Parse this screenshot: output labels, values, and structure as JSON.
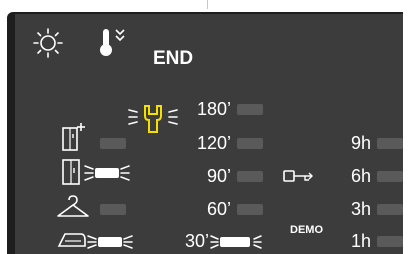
{
  "header": {
    "end_label": "END"
  },
  "timers": {
    "left_column": [
      "180’",
      "120’",
      "90’",
      "60’",
      "30’"
    ],
    "left_active": [
      false,
      false,
      false,
      false,
      true
    ],
    "right_column": [
      "9h",
      "6h",
      "3h",
      "1h"
    ],
    "right_active": [
      false,
      false,
      false,
      false
    ]
  },
  "demo_label": "DEMO",
  "icons": {
    "sun": "sun-icon",
    "thermo": "thermometer-snowflake-icon",
    "service": "wrench-service-icon",
    "fridge_plus": "fridge-add-icon",
    "fridge": "fridge-icon",
    "hanger": "hanger-icon",
    "iron": "iron-icon",
    "key": "key-icon"
  },
  "indicators": {
    "fridge_plus_active": false,
    "fridge_active": true,
    "hanger_active": false,
    "iron_active": true,
    "service_active": true
  },
  "colors": {
    "panel": "#3c3c3c",
    "bezel": "#1e1e1e",
    "accent": "#f5e000",
    "bar_off": "#5a5a5a",
    "bar_on": "#ffffff"
  }
}
